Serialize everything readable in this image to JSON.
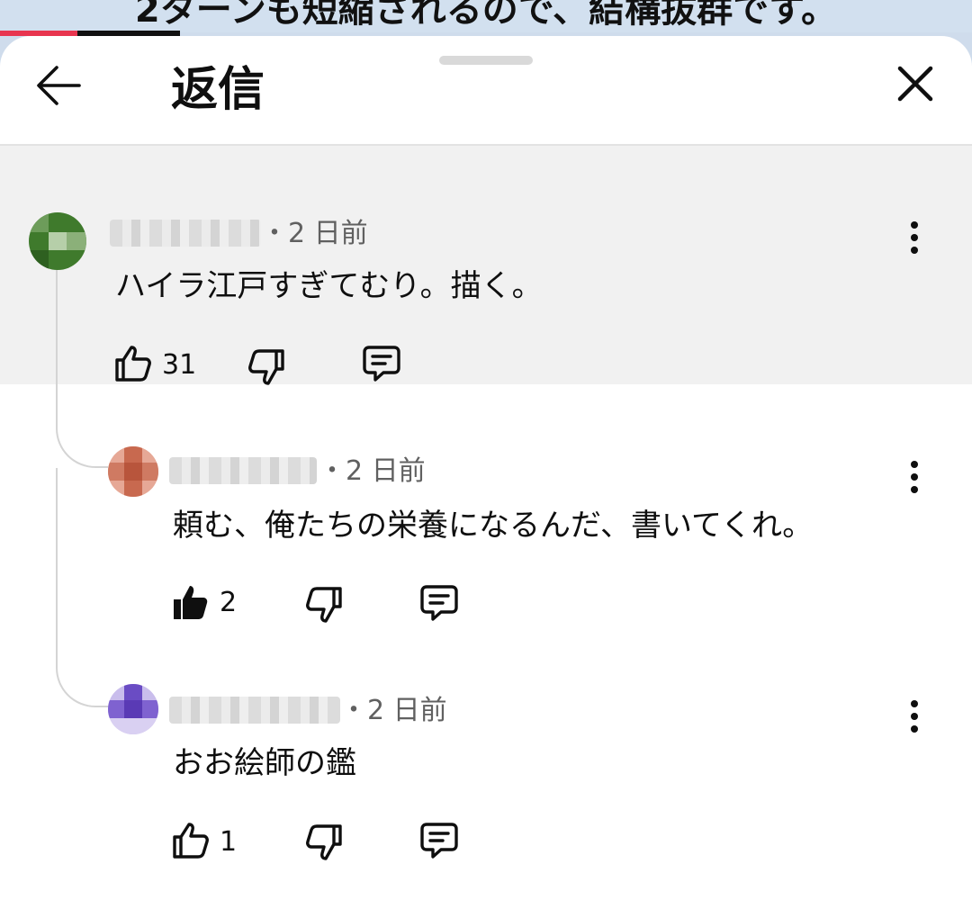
{
  "background_caption": "2ターンも短縮されるので、結構抜群です。",
  "header": {
    "title": "返信"
  },
  "comments": [
    {
      "author": "",
      "time": "2 日前",
      "text": "ハイラ江戸すぎてむり。描く。",
      "likes": "31",
      "liked": false,
      "avatar_color": "#3f7a2c"
    },
    {
      "author": "",
      "time": "2 日前",
      "text": "頼む、俺たちの栄養になるんだ、書いてくれ。",
      "likes": "2",
      "liked": true,
      "avatar_color": "#c8694f"
    },
    {
      "author": "",
      "time": "2 日前",
      "text": "おお絵師の鑑",
      "likes": "1",
      "liked": false,
      "avatar_color": "#6a4cc4"
    }
  ],
  "icons": {
    "back": "arrow-left-icon",
    "close": "close-icon",
    "more": "more-vert-icon",
    "like": "thumbs-up-icon",
    "dislike": "thumbs-down-icon",
    "reply": "comment-icon"
  }
}
